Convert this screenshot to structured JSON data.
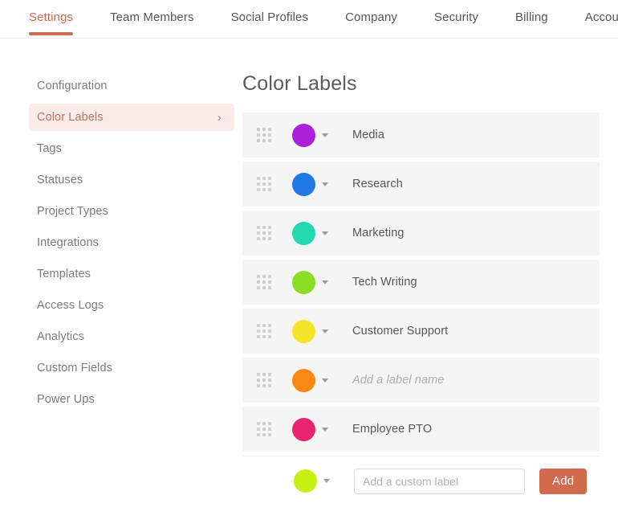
{
  "tabs": [
    {
      "label": "Settings",
      "active": true
    },
    {
      "label": "Team Members",
      "active": false
    },
    {
      "label": "Social Profiles",
      "active": false
    },
    {
      "label": "Company",
      "active": false
    },
    {
      "label": "Security",
      "active": false
    },
    {
      "label": "Billing",
      "active": false
    },
    {
      "label": "Account",
      "active": false
    }
  ],
  "sidebar": {
    "items": [
      {
        "label": "Configuration",
        "active": false,
        "chevron": ""
      },
      {
        "label": "Color Labels",
        "active": true,
        "chevron": "›"
      },
      {
        "label": "Tags",
        "active": false,
        "chevron": ""
      },
      {
        "label": "Statuses",
        "active": false,
        "chevron": ""
      },
      {
        "label": "Project Types",
        "active": false,
        "chevron": ""
      },
      {
        "label": "Integrations",
        "active": false,
        "chevron": ""
      },
      {
        "label": "Templates",
        "active": false,
        "chevron": ""
      },
      {
        "label": "Access Logs",
        "active": false,
        "chevron": ""
      },
      {
        "label": "Analytics",
        "active": false,
        "chevron": ""
      },
      {
        "label": "Custom Fields",
        "active": false,
        "chevron": ""
      },
      {
        "label": "Power Ups",
        "active": false,
        "chevron": ""
      }
    ]
  },
  "main": {
    "title": "Color Labels",
    "labels": [
      {
        "name": "Media",
        "color": "#a922d8",
        "is_placeholder": false
      },
      {
        "name": "Research",
        "color": "#2179e8",
        "is_placeholder": false
      },
      {
        "name": "Marketing",
        "color": "#21d8b2",
        "is_placeholder": false
      },
      {
        "name": "Tech Writing",
        "color": "#8ade24",
        "is_placeholder": false
      },
      {
        "name": "Customer Support",
        "color": "#f5e529",
        "is_placeholder": false
      },
      {
        "name": "Add a label name",
        "color": "#f98910",
        "is_placeholder": true
      },
      {
        "name": "Employee PTO",
        "color": "#e8246e",
        "is_placeholder": false
      }
    ],
    "add_row": {
      "color": "#c8f00f",
      "input_value": "",
      "input_placeholder": "Add a custom label",
      "button_label": "Add"
    }
  },
  "theme": {
    "accent": "#cd6e51",
    "accent_soft_bg": "#fbeceb",
    "row_bg": "#f5f5f5",
    "text": "#55555a",
    "muted_text": "#7a7a80"
  }
}
